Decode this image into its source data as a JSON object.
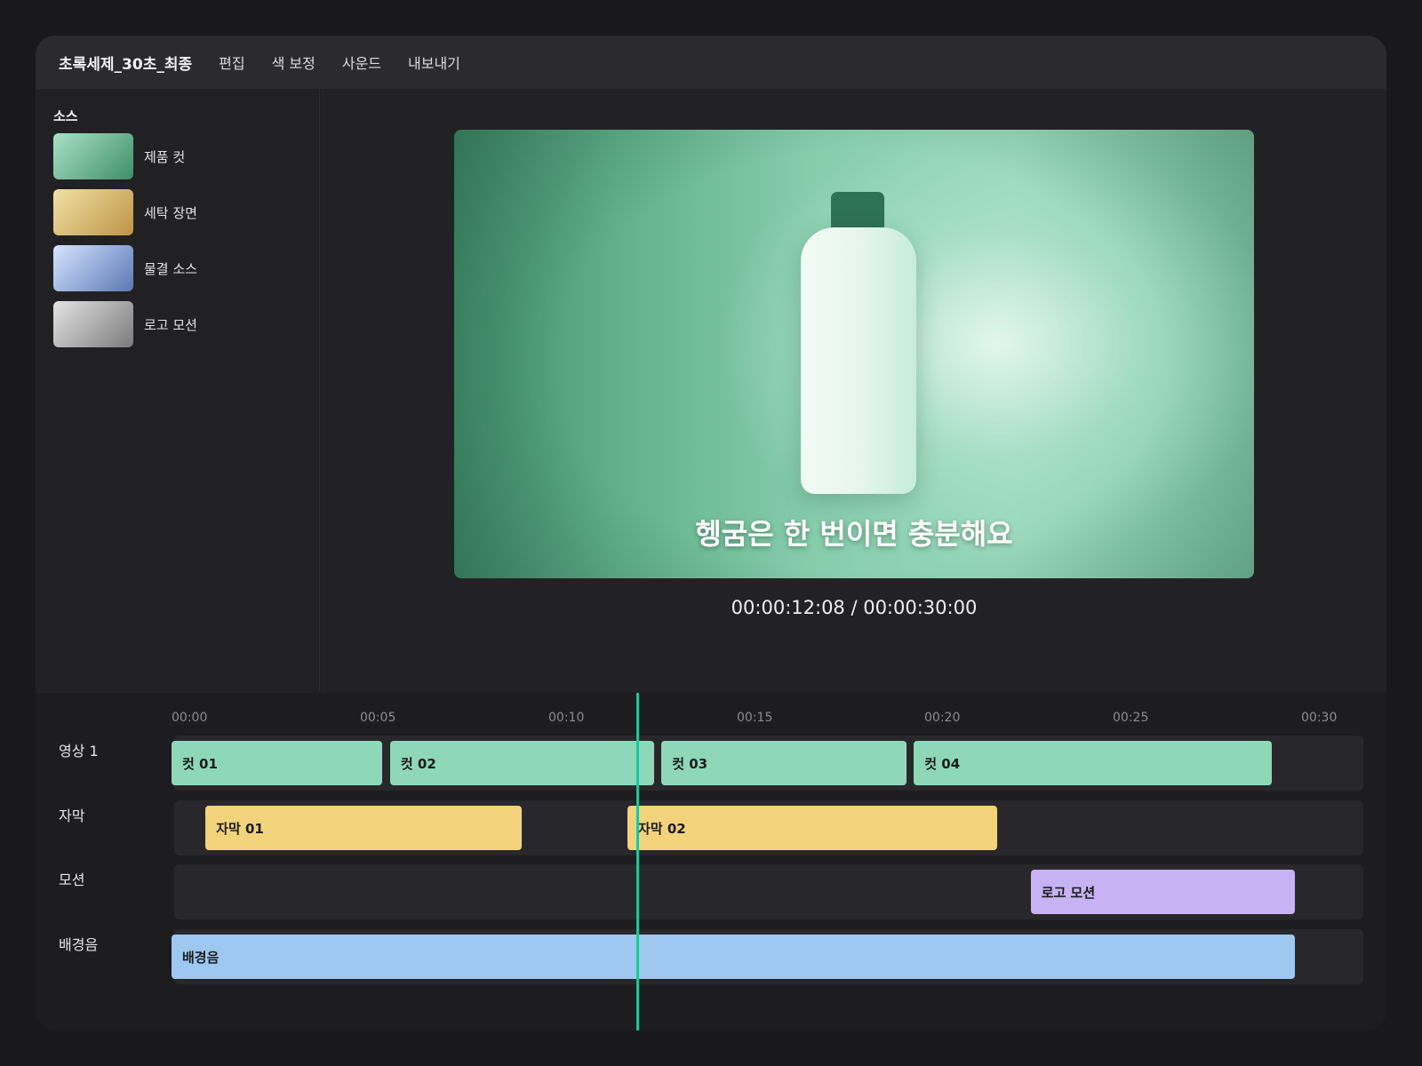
{
  "menubar": {
    "title": "초록세제_30초_최종",
    "items": [
      "편집",
      "색 보정",
      "사운드",
      "내보내기"
    ]
  },
  "sources": {
    "heading": "소스",
    "items": [
      {
        "label": "제품 컷",
        "colors": [
          "#a9e2c6",
          "#3f8e68"
        ]
      },
      {
        "label": "세탁 장면",
        "colors": [
          "#f2e0a6",
          "#bd9546"
        ]
      },
      {
        "label": "물결 소스",
        "colors": [
          "#d6e4ff",
          "#5a78b4"
        ]
      },
      {
        "label": "로고 모션",
        "colors": [
          "#e4e4e4",
          "#7a7a7a"
        ]
      }
    ]
  },
  "preview": {
    "subtitle": "헹굼은 한 번이면 충분해요",
    "timecode": "00:00:12:08 / 00:00:30:00"
  },
  "timeline": {
    "ruler": [
      "00:00",
      "00:05",
      "00:10",
      "00:15",
      "00:20",
      "00:25",
      "00:30"
    ],
    "playhead_seconds": 12.33,
    "tracks": [
      {
        "label": "영상 1",
        "clips": [
          {
            "label": "컷 01",
            "start": 0.0,
            "end": 5.6
          },
          {
            "label": "컷 02",
            "start": 5.8,
            "end": 12.8
          },
          {
            "label": "컷 03",
            "start": 13.0,
            "end": 19.5
          },
          {
            "label": "컷 04",
            "start": 19.7,
            "end": 29.2
          }
        ]
      },
      {
        "label": "자막",
        "clips": [
          {
            "label": "자막 01",
            "start": 0.9,
            "end": 9.3
          },
          {
            "label": "자막 02",
            "start": 12.1,
            "end": 21.9
          }
        ]
      },
      {
        "label": "모션",
        "clips": [
          {
            "label": "로고 모션",
            "start": 22.8,
            "end": 29.8
          }
        ]
      },
      {
        "label": "배경음",
        "clips": [
          {
            "label": "배경음",
            "start": 0.0,
            "end": 29.8
          }
        ]
      }
    ]
  },
  "colors": {
    "accent": "#22c49a",
    "video_clip": "#8ed8b9",
    "caption_clip": "#f2d37c",
    "motion_clip": "#c7b2f3",
    "audio_clip": "#9ec8f0"
  }
}
